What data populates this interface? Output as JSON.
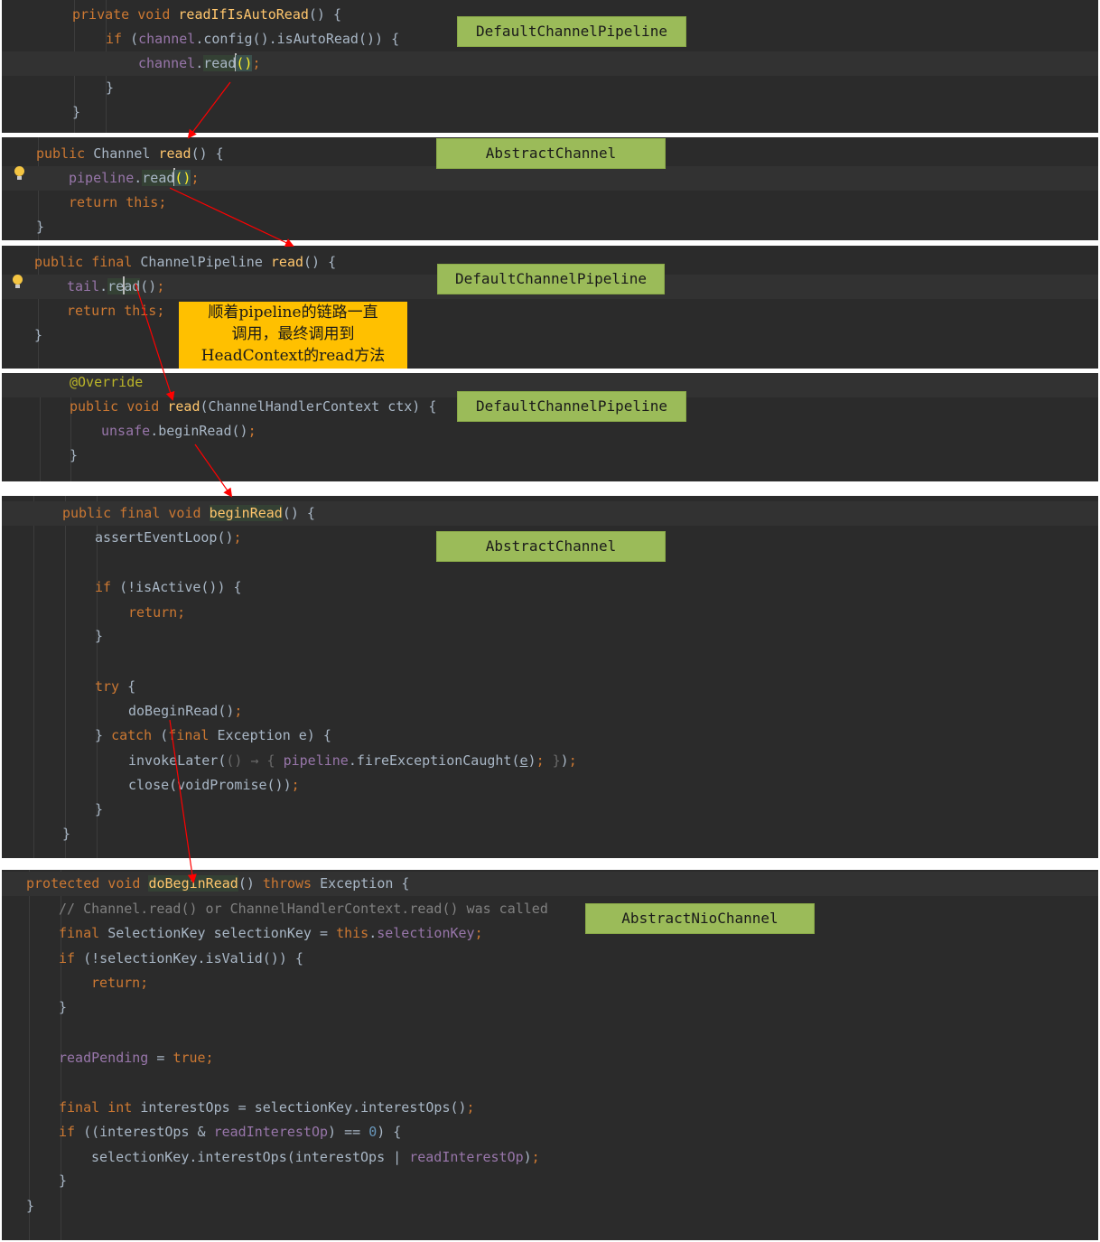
{
  "labels": {
    "p1": "DefaultChannelPipeline",
    "p2": "AbstractChannel",
    "p3": "DefaultChannelPipeline",
    "p4": "DefaultChannelPipeline",
    "p5": "AbstractChannel",
    "p6": "AbstractNioChannel"
  },
  "note": {
    "line1": "顺着pipeline的链路一直",
    "line2": "调用，最终调用到",
    "line3": "HeadContext的read方法"
  },
  "colors": {
    "editor_bg": "#2b2b2b",
    "keyword": "#cc7832",
    "method": "#ffc66d",
    "field": "#9876aa",
    "class_label_bg": "#9bbb59",
    "note_bg": "#ffc000",
    "arrow": "#ff0000"
  }
}
